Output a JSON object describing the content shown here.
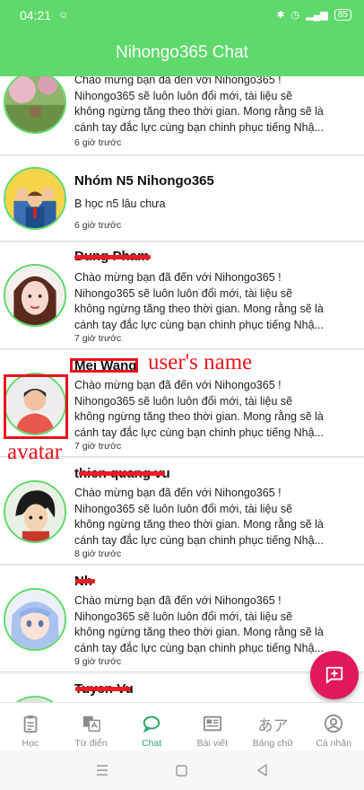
{
  "status_bar": {
    "time": "04:21",
    "battery": "85"
  },
  "header": {
    "title": "Nihongo365 Chat"
  },
  "chats": [
    {
      "name": "",
      "message_lines": [
        "Chào mừng bạn đã đến với Nihongo365 !",
        "Nihongo365 sẽ luôn luôn đổi mới, tài liệu sẽ",
        "không ngừng tăng theo thời gian. Mong rằng sẽ là",
        "cánh tay đắc lực cùng bạn chinh phục tiếng Nhậ..."
      ],
      "time": "6 giờ trước",
      "avatar_icon": "garden-photo-avatar"
    },
    {
      "name": "Nhóm N5 Nihongo365",
      "message_lines": [
        "B học n5 lâu chưa"
      ],
      "time": "6 giờ trước",
      "avatar_icon": "group-avatar"
    },
    {
      "name": "Dung Pham",
      "message_lines": [
        "Chào mừng bạn đã đến với Nihongo365 !",
        "Nihongo365 sẽ luôn luôn đổi mới, tài liệu sẽ",
        "không ngừng tăng theo thời gian. Mong rằng sẽ là",
        "cánh tay đắc lực cùng bạn chinh phục tiếng Nhậ..."
      ],
      "time": "7 giờ trước",
      "avatar_icon": "girl-photo-avatar"
    },
    {
      "name": "Mei Wang",
      "message_lines": [
        "Chào mừng bạn đã đến với Nihongo365 !",
        "Nihongo365 sẽ luôn luôn đổi mới, tài liệu sẽ",
        "không ngừng tăng theo thời gian. Mong rằng sẽ là",
        "cánh tay đắc lực cùng bạn chinh phục tiếng Nhậ..."
      ],
      "time": "7 giờ trước",
      "avatar_icon": "default-user-avatar"
    },
    {
      "name": "thien quang vu",
      "message_lines": [
        "Chào mừng bạn đã đến với Nihongo365 !",
        "Nihongo365 sẽ luôn luôn đổi mới, tài liệu sẽ",
        "không ngừng tăng theo thời gian. Mong rằng sẽ là",
        "cánh tay đắc lực cùng bạn chinh phục tiếng Nhậ..."
      ],
      "time": "8 giờ trước",
      "avatar_icon": "anime-boy-avatar"
    },
    {
      "name": "Nh",
      "message_lines": [
        "Chào mừng bạn đã đến với Nihongo365 !",
        "Nihongo365 sẽ luôn luôn đổi mới, tài liệu sẽ",
        "không ngừng tăng theo thời gian. Mong rằng sẽ là",
        "cánh tay đắc lực cùng bạn chinh phục tiếng Nhậ..."
      ],
      "time": "9 giờ trước",
      "avatar_icon": "anime-girl-avatar"
    },
    {
      "name": "Tuyen Vu",
      "message_lines": [],
      "time": "",
      "avatar_icon": "photo-avatar"
    }
  ],
  "annotations": {
    "user_name_label": "user's name",
    "avatar_label": "avatar"
  },
  "bottom_nav": [
    {
      "label": "Học",
      "icon": "clipboard-icon",
      "active": false
    },
    {
      "label": "Từ điển",
      "icon": "translate-icon",
      "active": false
    },
    {
      "label": "Chat",
      "icon": "chat-bubble-icon",
      "active": true
    },
    {
      "label": "Bài viết",
      "icon": "article-icon",
      "active": false
    },
    {
      "label": "Bảng chữ",
      "icon": "kana-icon",
      "active": false
    },
    {
      "label": "Cá nhân",
      "icon": "profile-icon",
      "active": false
    }
  ],
  "kana_glyph": "あア",
  "colors": {
    "primary": "#5fd96b",
    "fab": "#e0195f",
    "annotation": "#e8131c",
    "active_nav": "#2fa36b"
  }
}
